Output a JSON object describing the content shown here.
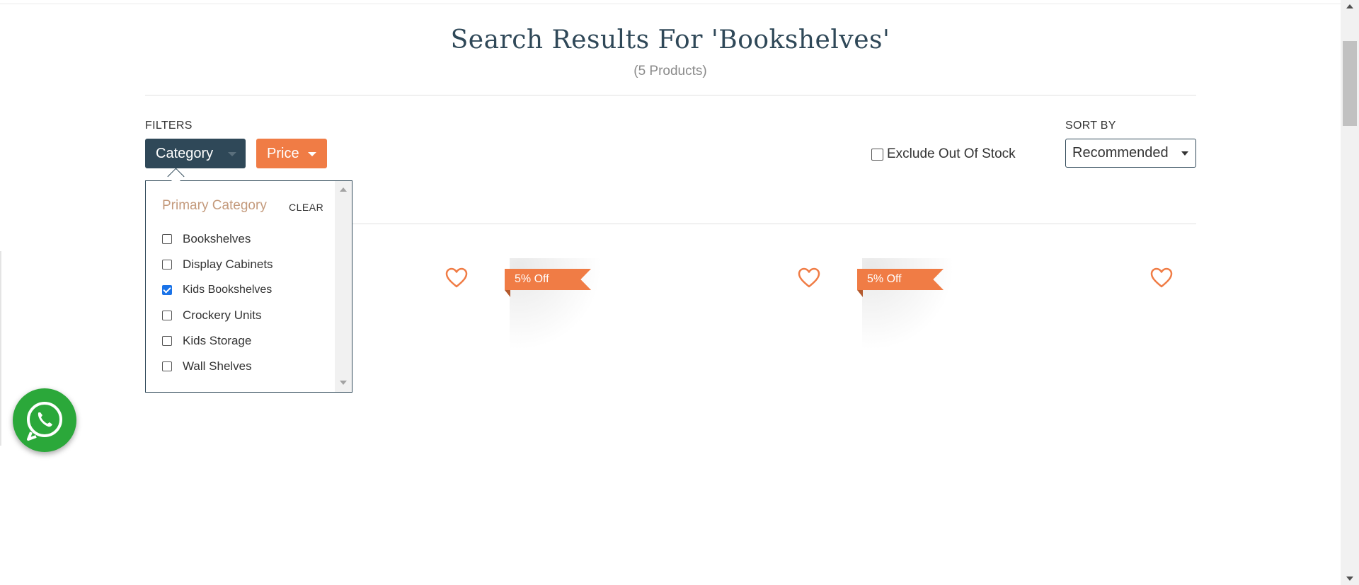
{
  "header": {
    "title": "Search Results For 'Bookshelves'",
    "count": "(5 Products)"
  },
  "filters": {
    "label": "FILTERS",
    "category_button": "Category",
    "price_button": "Price",
    "exclude_out_of_stock": "Exclude Out Of Stock",
    "exclude_checked": false
  },
  "sort": {
    "label": "SORT BY",
    "selected": "Recommended"
  },
  "dropdown": {
    "header": "Primary Category",
    "clear": "CLEAR",
    "items": [
      {
        "label": "Bookshelves",
        "checked": false
      },
      {
        "label": "Display Cabinets",
        "checked": false
      },
      {
        "label": "Kids Bookshelves",
        "checked": true
      },
      {
        "label": "Crockery Units",
        "checked": false
      },
      {
        "label": "Kids Storage",
        "checked": false
      },
      {
        "label": "Wall Shelves",
        "checked": false
      }
    ]
  },
  "products": [
    {
      "discount": ""
    },
    {
      "discount": "5% Off"
    },
    {
      "discount": "5% Off"
    }
  ],
  "colors": {
    "primary_dark": "#2f4858",
    "accent_orange": "#f07c45",
    "category_header": "#c49a7c",
    "whatsapp_green": "#2ba83a"
  },
  "icons": [
    "heart-icon",
    "whatsapp-icon",
    "chevron-down-icon"
  ]
}
